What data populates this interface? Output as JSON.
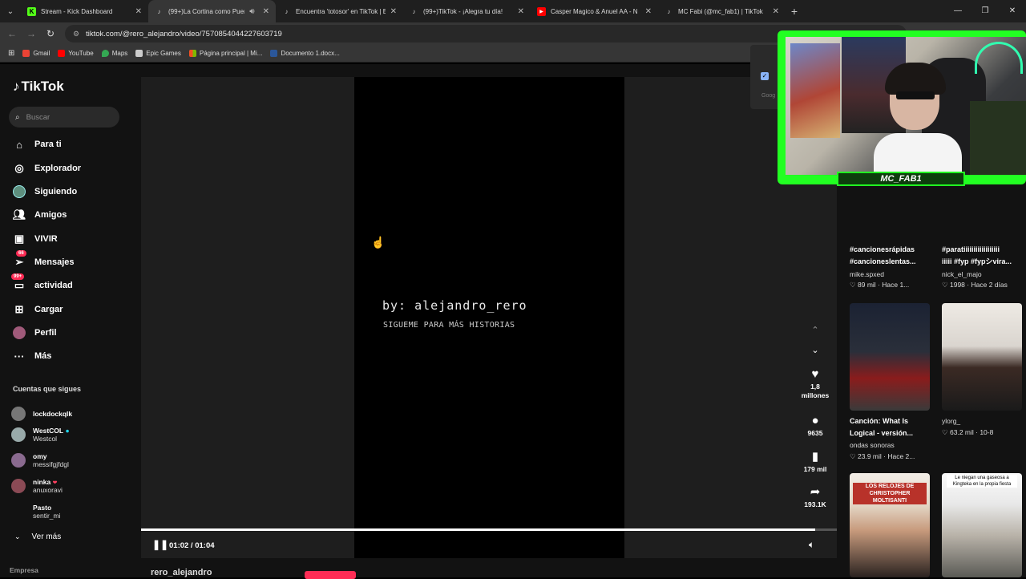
{
  "browser": {
    "tabs": [
      {
        "label": "Stream - Kick Dashboard",
        "icon": "kick-icon",
        "color": "#53fc18",
        "active": false
      },
      {
        "label": "(99+)La Cortina como Puer",
        "icon": "tiktok-icon",
        "color": "#ffffff",
        "active": true
      },
      {
        "label": "Encuentra 'totosor' en TikTok | E",
        "icon": "tiktok-icon",
        "color": "#ffffff",
        "active": false
      },
      {
        "label": "(99+)TikTok - ¡Alegra tu día!",
        "icon": "tiktok-icon",
        "color": "#ffffff",
        "active": false
      },
      {
        "label": "Casper Magico & Anuel AA - N",
        "icon": "youtube-icon",
        "color": "#ff0000",
        "active": false
      },
      {
        "label": "MC Fabi (@mc_fab1) | TikTok",
        "icon": "tiktok-icon",
        "color": "#ffffff",
        "active": false
      }
    ],
    "url": "tiktok.com/@rero_alejandro/video/7570854044227603719",
    "bookmarks": [
      {
        "label": "Gmail",
        "color": "#ea4335"
      },
      {
        "label": "YouTube",
        "color": "#ff0000"
      },
      {
        "label": "Maps",
        "color": "#34a853"
      },
      {
        "label": "Epic Games",
        "color": "#cccccc"
      },
      {
        "label": "Página principal | Mi...",
        "color": "#f25022"
      },
      {
        "label": "Documento 1.docx...",
        "color": "#2b579a"
      }
    ]
  },
  "sidebar": {
    "logo": "TikTok",
    "search_placeholder": "Buscar",
    "nav": [
      {
        "label": "Para ti",
        "icon": "home-icon"
      },
      {
        "label": "Explorador",
        "icon": "compass-icon"
      },
      {
        "label": "Siguiendo",
        "icon": "following-avatar-icon"
      },
      {
        "label": "Amigos",
        "icon": "friends-icon"
      },
      {
        "label": "VIVIR",
        "icon": "live-icon"
      },
      {
        "label": "Mensajes",
        "icon": "messages-icon",
        "badge": "66"
      },
      {
        "label": "actividad",
        "icon": "activity-icon",
        "badge": "99+"
      },
      {
        "label": "Cargar",
        "icon": "upload-icon"
      },
      {
        "label": "Perfil",
        "icon": "profile-avatar-icon"
      },
      {
        "label": "Más",
        "icon": "more-icon"
      }
    ],
    "following_title": "Cuentas que sigues",
    "accounts": [
      {
        "name": "lockdockqlk",
        "sub": ""
      },
      {
        "name": "WestCOL",
        "sub": "Westcol",
        "verified": true
      },
      {
        "name": "omy",
        "sub": "messifgjfdgl"
      },
      {
        "name": "ninka",
        "sub": "anuxoravi"
      },
      {
        "name": "Pasto",
        "sub": "sentir_mi"
      }
    ],
    "see_more": "Ver más",
    "footer": "Empresa"
  },
  "video": {
    "overlay_line1": "by: alejandro_rero",
    "overlay_line2": "SIGUEME PARA MÁS HISTORIAS",
    "time": "01:02 / 01:04",
    "progress": 0.969,
    "author": "rero_alejandro"
  },
  "actions": {
    "likes": "1,8 millones",
    "comments": "9635",
    "saves": "179 mil",
    "shares": "193.1K"
  },
  "related": [
    {
      "title1": "#cancionesrápidas",
      "title2": "#cancioneslentas...",
      "author": "mike.spxed",
      "likes": "89 mil",
      "age": "Hace 1..."
    },
    {
      "title1": "#paratiiiiiiiiiiiiiiiiii",
      "title2": "iiiii #fyp #fypシvira...",
      "author": "nick_el_majo",
      "likes": "1998",
      "age": "Hace 2 días"
    },
    {
      "title1": "Canción: What Is",
      "title2": "Logical - versión...",
      "author": "ondas sonoras",
      "likes": "23.9 mil",
      "age": "Hace 2..."
    },
    {
      "title1": "",
      "title2": "",
      "author": "ylorg_",
      "likes": "63.2 mil",
      "age": "10-8"
    },
    {
      "thumb_text": "LOS RELOJES DE CHRISTOPHER MOLTISANTI"
    },
    {
      "thumb_text": "Le niegan una gaseosa a Kingteka en la propia fiesta"
    }
  ],
  "webcam": {
    "label": "MC_FAB1"
  }
}
